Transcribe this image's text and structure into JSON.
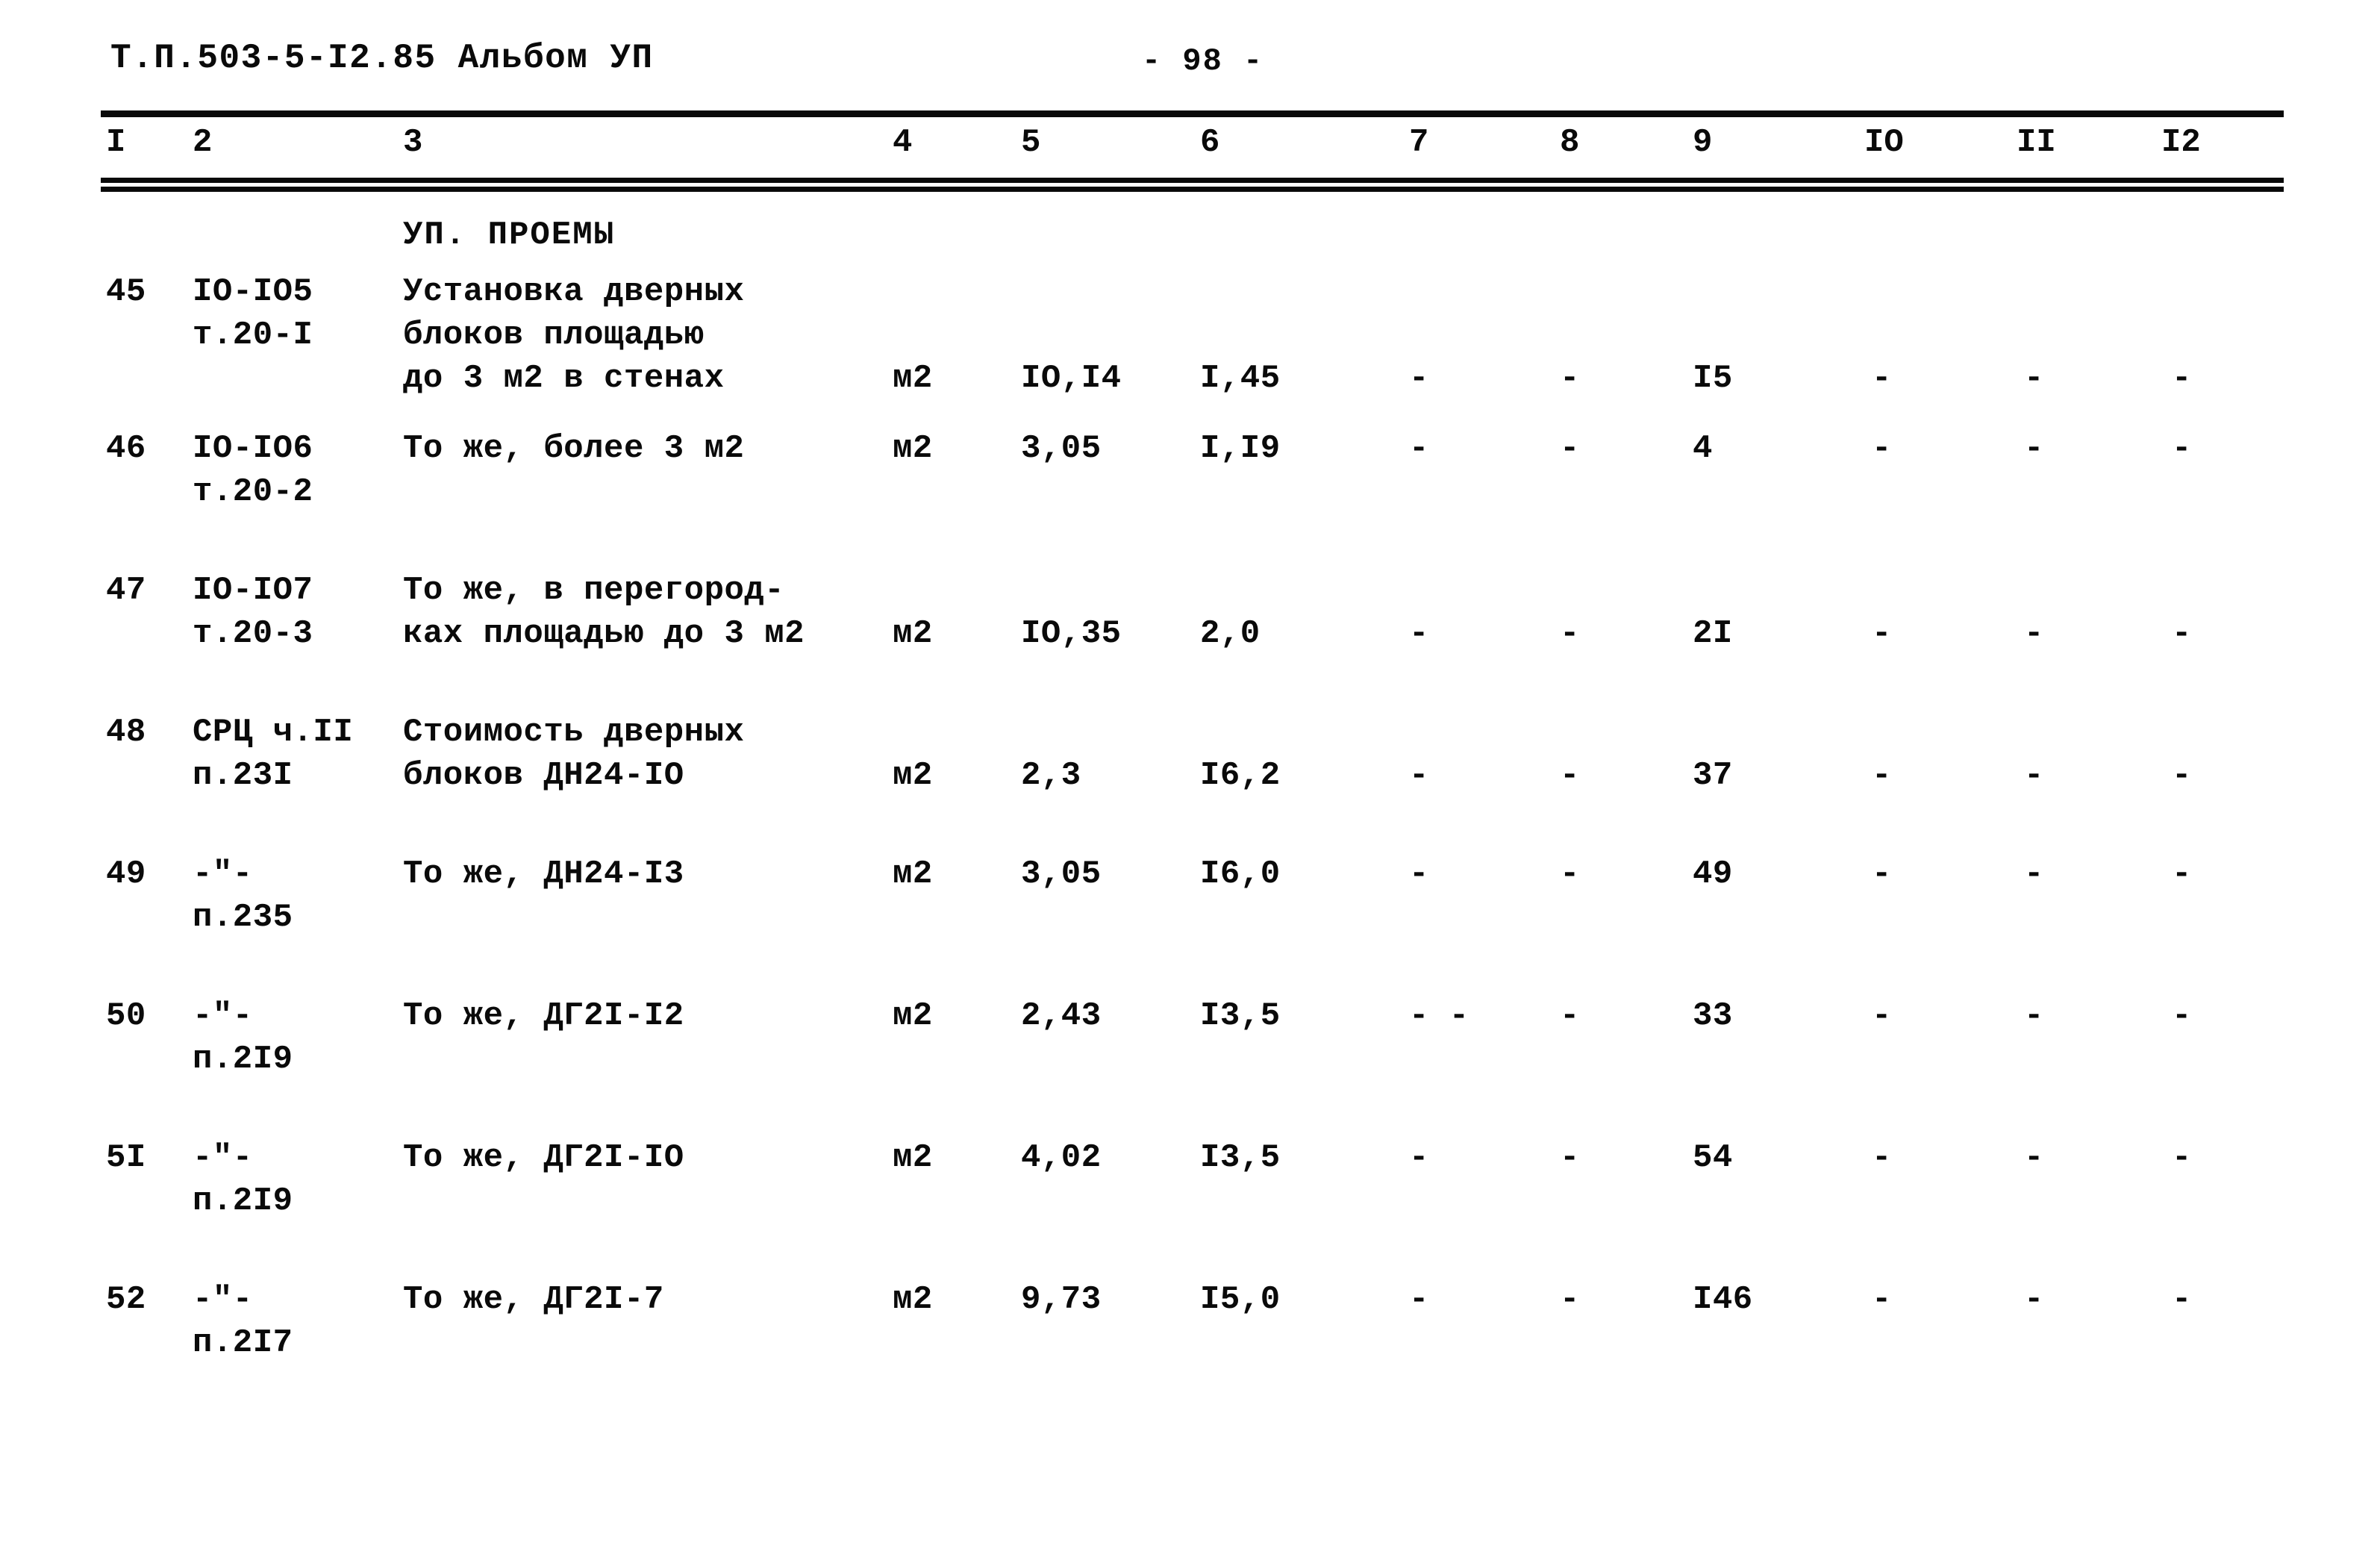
{
  "header": {
    "doc_code": "Т.П.503-5-I2.85 Альбом УП",
    "page_number": "- 98 -"
  },
  "table": {
    "column_headers": [
      "I",
      "2",
      "3",
      "4",
      "5",
      "6",
      "7",
      "8",
      "9",
      "IO",
      "II",
      "I2"
    ],
    "section_title": "УП. ПРОЕМЫ",
    "rows": [
      {
        "num": "45",
        "code_line1": "IO-IO5",
        "code_line2": "т.20-I",
        "desc_line1": "Установка дверных",
        "desc_line2": "блоков площадью",
        "desc_line3": "до 3 м2 в стенах",
        "unit": "м2",
        "c5": "IO,I4",
        "c6": "I,45",
        "c7": "-",
        "c8": "-",
        "c9": "I5",
        "c10": "-",
        "c11": "-",
        "c12": "-"
      },
      {
        "num": "46",
        "code_line1": "IO-IO6",
        "code_line2": "т.20-2",
        "desc_line1": "То же, более 3 м2",
        "desc_line2": "",
        "desc_line3": "",
        "unit": "м2",
        "c5": "3,05",
        "c6": "I,I9",
        "c7": "-",
        "c8": "-",
        "c9": "4",
        "c10": "-",
        "c11": "-",
        "c12": "-"
      },
      {
        "num": "47",
        "code_line1": "IO-IO7",
        "code_line2": "т.20-3",
        "desc_line1": "То же, в перегород-",
        "desc_line2": "ках площадью до 3 м2",
        "desc_line3": "",
        "unit": "м2",
        "c5": "IO,35",
        "c6": "2,0",
        "c7": "-",
        "c8": "-",
        "c9": "2I",
        "c10": "-",
        "c11": "-",
        "c12": "-"
      },
      {
        "num": "48",
        "code_line1": "СРЦ ч.II",
        "code_line2": "п.23I",
        "desc_line1": "Стоимость дверных",
        "desc_line2": "блоков ДН24-IO",
        "desc_line3": "",
        "unit": "м2",
        "c5": "2,3",
        "c6": "I6,2",
        "c7": "-",
        "c8": "-",
        "c9": "37",
        "c10": "-",
        "c11": "-",
        "c12": "-"
      },
      {
        "num": "49",
        "code_line1": "-\"-",
        "code_line2": "п.235",
        "desc_line1": "То же, ДН24-I3",
        "desc_line2": "",
        "desc_line3": "",
        "unit": "м2",
        "c5": "3,05",
        "c6": "I6,0",
        "c7": "-",
        "c8": "-",
        "c9": "49",
        "c10": "-",
        "c11": "-",
        "c12": "-"
      },
      {
        "num": "50",
        "code_line1": "-\"-",
        "code_line2": "п.2I9",
        "desc_line1": "То же, ДГ2I-I2",
        "desc_line2": "",
        "desc_line3": "",
        "unit": "м2",
        "c5": "2,43",
        "c6": "I3,5",
        "c7": "- -",
        "c8": "-",
        "c9": "33",
        "c10": "-",
        "c11": "-",
        "c12": "-"
      },
      {
        "num": "5I",
        "code_line1": "-\"-",
        "code_line2": "п.2I9",
        "desc_line1": "То же, ДГ2I-IO",
        "desc_line2": "",
        "desc_line3": "",
        "unit": "м2",
        "c5": "4,02",
        "c6": "I3,5",
        "c7": "-",
        "c8": "-",
        "c9": "54",
        "c10": "-",
        "c11": "-",
        "c12": "-"
      },
      {
        "num": "52",
        "code_line1": "-\"-",
        "code_line2": "п.2I7",
        "desc_line1": "То же, ДГ2I-7",
        "desc_line2": "",
        "desc_line3": "",
        "unit": "м2",
        "c5": "9,73",
        "c6": "I5,0",
        "c7": "-",
        "c8": "-",
        "c9": "I46",
        "c10": "-",
        "c11": "-",
        "c12": "-"
      }
    ]
  }
}
